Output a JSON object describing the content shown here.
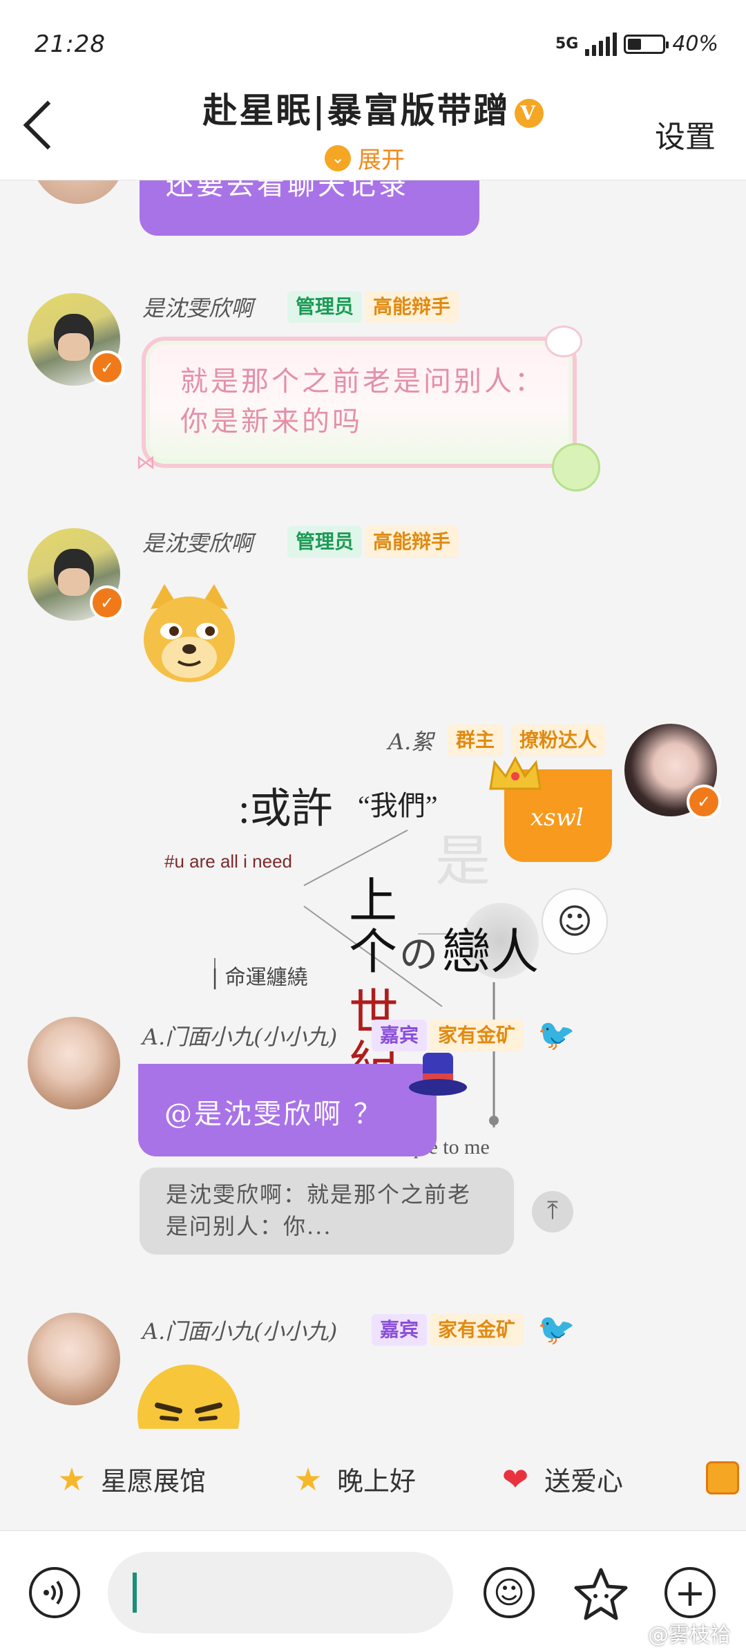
{
  "status_bar": {
    "time": "21:28",
    "network": "5G",
    "battery": "40%",
    "battery_level": 0.4
  },
  "header": {
    "title": "赴星眠|暴富版带蹭",
    "verified_badge": "V",
    "expand_label": "展开",
    "settings_label": "设置"
  },
  "messages": [
    {
      "type": "text",
      "text": "还要去看聊天记录"
    },
    {
      "sender": "是沈雯欣啊",
      "tags": [
        "管理员",
        "高能辩手"
      ],
      "type": "text",
      "text": "就是那个之前老是问别人：你是新来的吗"
    },
    {
      "sender": "是沈雯欣啊",
      "tags": [
        "管理员",
        "高能辩手"
      ],
      "type": "sticker",
      "icon": "doge-face-icon"
    },
    {
      "sender": "A.絮",
      "tags": [
        "群主",
        "撩粉达人"
      ],
      "type": "text",
      "text": "xswl"
    },
    {
      "sender": "A.门面小九(小小九)",
      "tags": [
        "嘉宾",
        "家有金矿"
      ],
      "type": "text",
      "text": "@是沈雯欣啊 ？",
      "quote": "是沈雯欣啊：就是那个之前老是问别人：你..."
    },
    {
      "sender": "A.门面小九(小小九)",
      "tags": [
        "嘉宾",
        "家有金矿"
      ],
      "type": "sticker",
      "icon": "smirk-face-icon"
    }
  ],
  "background_art": {
    "line1": ":或許",
    "line1b": "“我們”",
    "hashtag": "#u are all i need",
    "big1": "是",
    "big2": "上个",
    "big3": "世",
    "big4": "紀",
    "no": "の",
    "lovers": "戀人",
    "fate": "| 命運纏繞",
    "unique": "are unique to me"
  },
  "quick_replies": [
    {
      "label": "星愿展馆",
      "icon": "star-icon"
    },
    {
      "label": "晚上好",
      "icon": "smiling-star-icon"
    },
    {
      "label": "送爱心",
      "icon": "heart-icon"
    }
  ],
  "watermark": "@雾枝袷",
  "colors": {
    "purple_bubble": "#a973e8",
    "orange_bubble": "#f79a1e",
    "admin_green": "#1c9a55",
    "gold_tag": "#e08a10"
  }
}
